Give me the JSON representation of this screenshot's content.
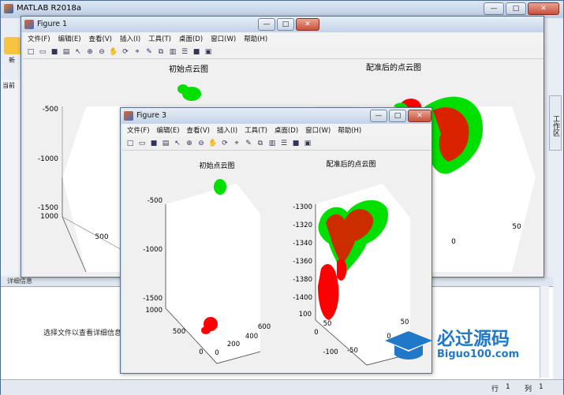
{
  "matlab": {
    "title": "MATLAB R2018a",
    "min": "—",
    "max": "□",
    "close": "✕",
    "left_labels": [
      "新",
      "当前"
    ],
    "detail_header": "详细信息",
    "detail_message": "选择文件以查看详细信息",
    "right_tab": "工作区",
    "status_row_label": "行",
    "status_row": "1",
    "status_col_label": "列",
    "status_col": "1"
  },
  "menus": [
    "文件(F)",
    "编辑(E)",
    "查看(V)",
    "插入(I)",
    "工具(T)",
    "桌面(D)",
    "窗口(W)",
    "帮助(H)"
  ],
  "figure1": {
    "title": "Figure 1",
    "left_plot": {
      "title": "初始点云图",
      "z_ticks": [
        "-500",
        "-1000",
        "-1500"
      ],
      "x_ticks": [
        "1000",
        "500"
      ]
    },
    "right_plot": {
      "title": "配准后的点云图",
      "y_ticks": [
        "50",
        "0"
      ]
    }
  },
  "figure3": {
    "title": "Figure 3",
    "left_plot": {
      "title": "初始点云图",
      "z_ticks": [
        "-500",
        "-1000",
        "-1500"
      ],
      "x_ticks": [
        "1000",
        "500",
        "0"
      ],
      "y_ticks": [
        "600",
        "400",
        "200",
        "0"
      ]
    },
    "right_plot": {
      "title": "配准后的点云图",
      "z_ticks": [
        "-1300",
        "-1320",
        "-1340",
        "-1360",
        "-1380",
        "-1400"
      ],
      "x_ticks": [
        "100",
        "50",
        "0"
      ],
      "y_ticks": [
        "50",
        "0",
        "-50",
        "-100"
      ]
    }
  },
  "colors": {
    "source_cloud": "#ff0000",
    "target_cloud": "#00e000",
    "accent": "#1f78c8"
  },
  "watermark": {
    "text": "必过源码",
    "url": "Biguo100.com"
  }
}
